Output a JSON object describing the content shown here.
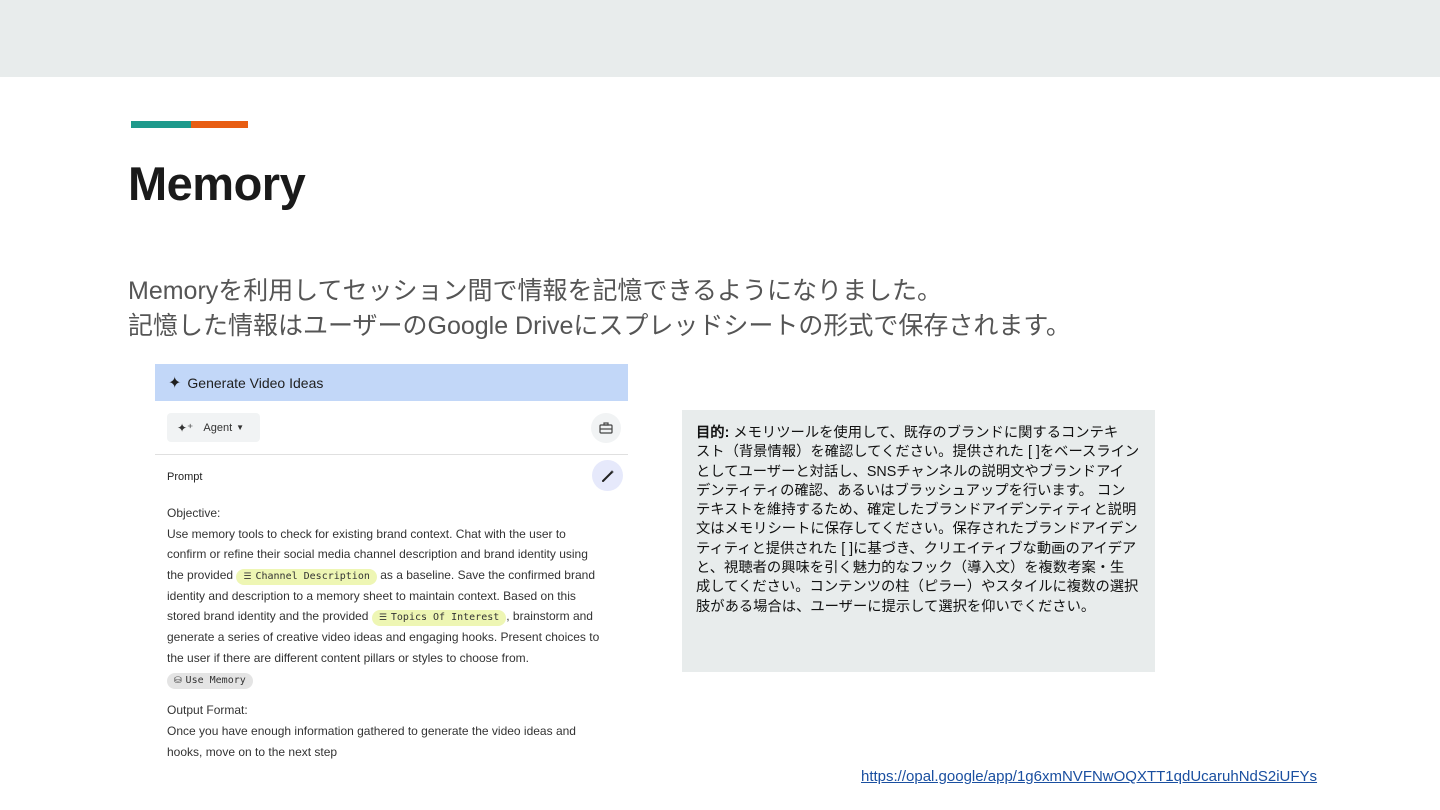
{
  "slide": {
    "title": "Memory",
    "intro_lines": [
      "Memoryを利用してセッション間で情報を記憶できるようになりました。",
      "記憶した情報はユーザーのGoogle Driveにスプレッドシートの形式で保存されます。"
    ],
    "link": "https://opal.google/app/1g6xmNVFNwOQXTT1qdUcaruhNdS2iUFYs"
  },
  "colors": {
    "accent_teal": "#1e9a8c",
    "accent_orange": "#e85d12",
    "header_blue": "#c2d7f8",
    "chip_yellow": "#eef6b4",
    "box_grey": "#e8ecec"
  },
  "screenshot": {
    "header_icon": "sparkle-icon",
    "header_title": "Generate Video Ideas",
    "agent_label": "Agent",
    "prompt_label": "Prompt",
    "objective_label": "Objective:",
    "lines": {
      "l1": "Use memory tools to check for existing brand context. Chat with the user to",
      "l2": "confirm or refine their social media channel description and brand identity using",
      "l3_pre": "the provided",
      "chip_channel": "Channel Description",
      "l3_post": "as a baseline. Save the confirmed brand",
      "l4": "identity and description to a memory sheet to maintain context. Based on this",
      "l5_pre": "stored brand identity and the provided",
      "chip_topics": "Topics Of Interest",
      "l5_post": ", brainstorm and",
      "l6": "generate a series of creative video ideas and engaging hooks. Present choices to",
      "l7": "the user if there are different content pillars or styles to choose from.",
      "chip_memory": "Use Memory"
    },
    "output_label": "Output Format:",
    "output_lines": [
      "Once you have enough information gathered to generate the video ideas and",
      "hooks, move on to the next step"
    ]
  },
  "jp_box": {
    "label": "目的:",
    "lines": [
      " メモリツールを使用して、既存のブランドに関するコンテキ",
      "スト（背景情報）を確認してください。提供された [ ]をベースライン",
      "としてユーザーと対話し、SNSチャンネルの説明文やブランドアイ",
      "デンティティの確認、あるいはブラッシュアップを行います。 コン",
      "テキストを維持するため、確定したブランドアイデンティティと説明",
      "文はメモリシートに保存してください。保存されたブランドアイデン",
      "ティティと提供された [ ]に基づき、クリエイティブな動画のアイデア",
      "と、視聴者の興味を引く魅力的なフック（導入文）を複数考案・生",
      "成してください。コンテンツの柱（ピラー）やスタイルに複数の選択",
      "肢がある場合は、ユーザーに提示して選択を仰いでください。"
    ]
  }
}
